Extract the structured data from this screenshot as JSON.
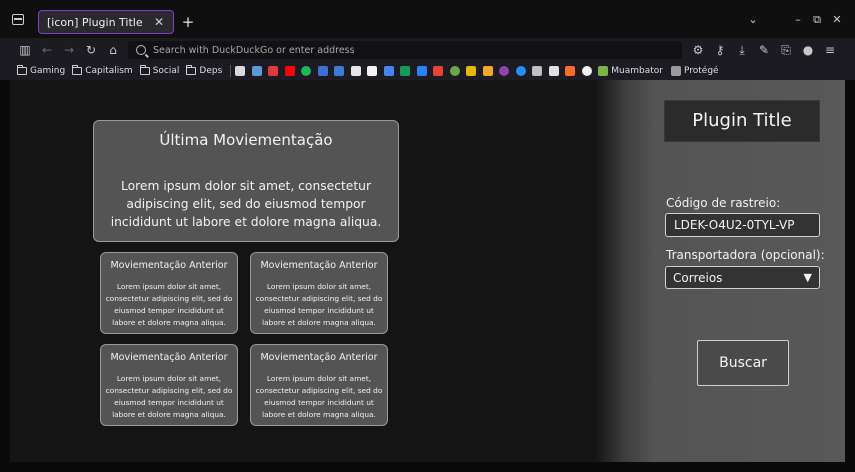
{
  "browser": {
    "tab_title": "[icon] Plugin Title",
    "tab_close": "✕",
    "new_tab": "+",
    "url_placeholder": "Search with DuckDuckGo or enter address",
    "bookmark_folders": [
      "Gaming",
      "Capitalism",
      "Social",
      "Deps"
    ],
    "bookmark_named": [
      "Muambator",
      "Protégé"
    ]
  },
  "page": {
    "plugin_title": "Plugin Title",
    "tracking_label": "Código de rastreio:",
    "tracking_value": "LDEK-O4U2-0TYL-VP",
    "carrier_label": "Transportadora (opcional):",
    "carrier_selected": "Correios",
    "carrier_arrow": "▼",
    "search_button": "Buscar",
    "latest": {
      "title": "Última Moviementação",
      "body": "Lorem ipsum dolor sit amet, consectetur adipiscing elit, sed do eiusmod tempor incididunt ut labore et dolore magna aliqua."
    },
    "previous": [
      {
        "title": "Moviementação Anterior",
        "body": "Lorem ipsum dolor sit amet, consectetur adipiscing elit, sed do eiusmod tempor incididunt ut labore et dolore magna aliqua."
      },
      {
        "title": "Moviementação Anterior",
        "body": "Lorem ipsum dolor sit amet, consectetur adipiscing elit, sed do eiusmod tempor incididunt ut labore et dolore magna aliqua."
      },
      {
        "title": "Moviementação Anterior",
        "body": "Lorem ipsum dolor sit amet, consectetur adipiscing elit, sed do eiusmod tempor incididunt ut labore et dolore magna aliqua."
      },
      {
        "title": "Moviementação Anterior",
        "body": "Lorem ipsum dolor sit amet, consectetur adipiscing elit, sed do eiusmod tempor incididunt ut labore et dolore magna aliqua."
      }
    ]
  },
  "colors": {
    "tab_border": "#7b3ed1",
    "card_bg": "#545454",
    "panel_bg": "#595959"
  }
}
